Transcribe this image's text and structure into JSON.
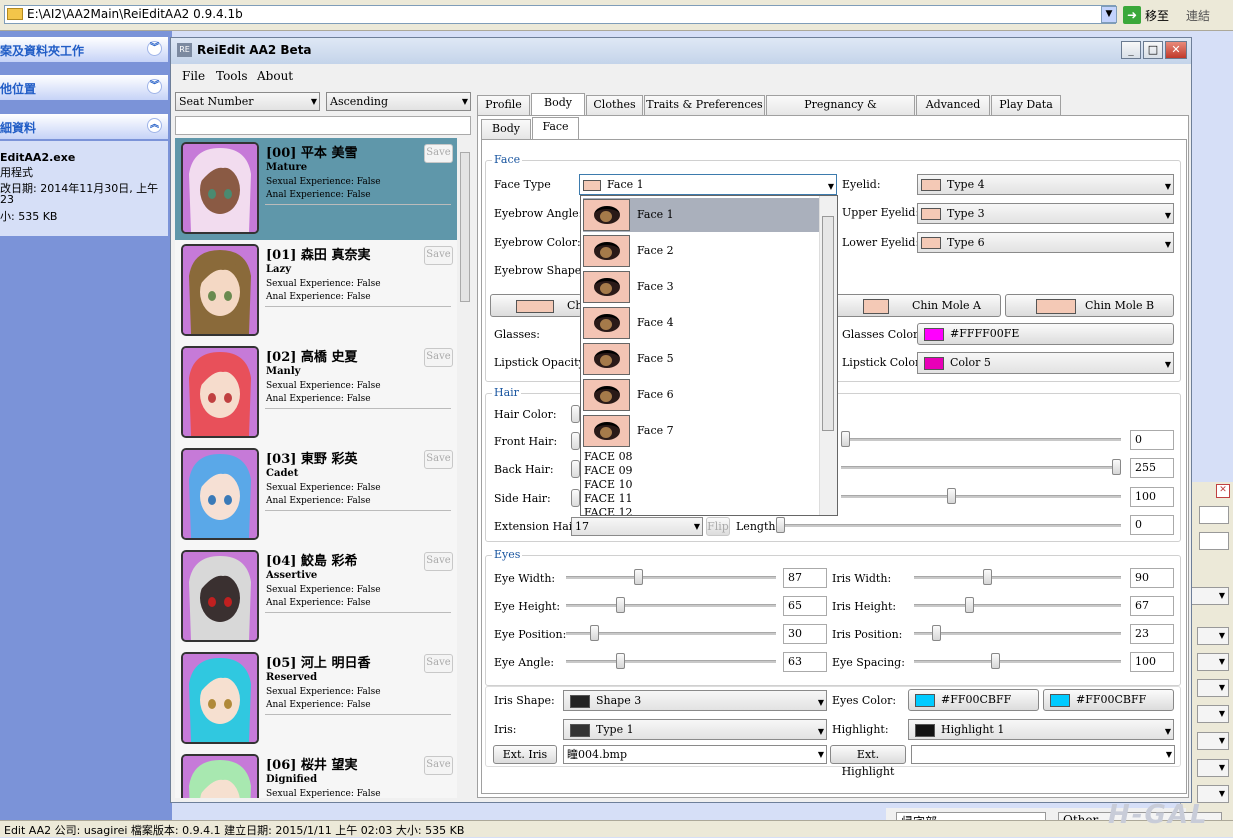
{
  "explorer": {
    "address": "E:\\AI2\\AA2Main\\ReiEditAA2 0.9.4.1b",
    "go_label": "移至",
    "links_label": "連結",
    "left_panel": {
      "sections": [
        "案及資料夾工作",
        "他位置",
        "細資料"
      ],
      "file_name": "EditAA2.exe",
      "file_type": "用程式",
      "modified": "改日期: 2014年11月30日, 上午",
      "modified2": "23",
      "size": "小: 535 KB"
    },
    "statusbar": "Edit AA2 公司: usagirei 檔案版本: 0.9.4.1 建立日期: 2015/1/11 上午 02:03 大小: 535 KB",
    "bg_field1": "帰宅部",
    "bg_field2": "Other",
    "watermark": "H-GAL"
  },
  "app": {
    "title": "ReiEdit AA2 Beta",
    "icon_text": "RE",
    "menu": [
      "File",
      "Tools",
      "About"
    ],
    "sort_field": "Seat Number",
    "sort_order": "Ascending",
    "save_label": "Save",
    "characters": [
      {
        "name": "[00] 平本 美雪",
        "personality": "Mature",
        "sexual": "Sexual Experience: False",
        "anal": "Anal Experience: False",
        "hair": "#f2dcef",
        "skin": "#8a5a44",
        "bg": "#c67ad8",
        "eyes": "#4a8a70"
      },
      {
        "name": "[01] 森田 真奈実",
        "personality": "Lazy",
        "sexual": "Sexual Experience: False",
        "anal": "Anal Experience: False",
        "hair": "#8a6a3a",
        "skin": "#f4d8c4",
        "bg": "#c67ad8",
        "eyes": "#6a8a50"
      },
      {
        "name": "[02] 高橋 史夏",
        "personality": "Manly",
        "sexual": "Sexual Experience: False",
        "anal": "Anal Experience: False",
        "hair": "#e8505a",
        "skin": "#f6dccc",
        "bg": "#c67ad8",
        "eyes": "#c04040"
      },
      {
        "name": "[03] 東野 彩英",
        "personality": "Cadet",
        "sexual": "Sexual Experience: False",
        "anal": "Anal Experience: False",
        "hair": "#5aa8e8",
        "skin": "#f6e0d4",
        "bg": "#c67ad8",
        "eyes": "#3a7ab8"
      },
      {
        "name": "[04] 鮫島 彩希",
        "personality": "Assertive",
        "sexual": "Sexual Experience: False",
        "anal": "Anal Experience: False",
        "hair": "#d8d8d8",
        "skin": "#3a3030",
        "bg": "#c67ad8",
        "eyes": "#c02020"
      },
      {
        "name": "[05] 河上 明日香",
        "personality": "Reserved",
        "sexual": "Sexual Experience: False",
        "anal": "Anal Experience: False",
        "hair": "#30c8e0",
        "skin": "#f6e0d0",
        "bg": "#c67ad8",
        "eyes": "#b08a3a"
      },
      {
        "name": "[06] 桜井 望実",
        "personality": "Dignified",
        "sexual": "Sexual Experience: False",
        "anal": "Anal Experience: False",
        "hair": "#a8e8b0",
        "skin": "#f6e0d0",
        "bg": "#c67ad8",
        "eyes": "#6a8a50"
      }
    ],
    "tabs": [
      "Profile",
      "Body",
      "Clothes",
      "Traits & Preferences",
      "Pregnancy & Compatibility",
      "Advanced",
      "Play Data"
    ],
    "subtabs": [
      "Body",
      "Face"
    ],
    "face": {
      "group": "Face",
      "face_type_label": "Face Type",
      "face_type_value": "Face 1",
      "eyebrow_angle_label": "Eyebrow Angle:",
      "eyebrow_color_label": "Eyebrow Color:",
      "eyebrow_shape_label": "Eyebrow Shape:",
      "eyelid_label": "Eyelid:",
      "eyelid_value": "Type 4",
      "upper_eyelid_label": "Upper Eyelid:",
      "upper_eyelid_value": "Type 3",
      "lower_eyelid_label": "Lower Eyelid:",
      "lower_eyelid_value": "Type 6",
      "cheek_button": "Ch",
      "chin_a": "Chin Mole A",
      "chin_b": "Chin Mole B",
      "glasses_label": "Glasses:",
      "glasses_color_label": "Glasses Color:",
      "glasses_color_value": "#FFFF00FE",
      "lipstick_opacity_label": "Lipstick Opacity:",
      "lipstick_color_label": "Lipstick Color:",
      "lipstick_color_value": "Color 5",
      "dropdown_items": [
        "Face 1",
        "Face 2",
        "Face 3",
        "Face 4",
        "Face 5",
        "Face 6",
        "Face 7"
      ],
      "dropdown_text_items": [
        "FACE 08",
        "FACE 09",
        "FACE 10",
        "FACE 11",
        "FACE 12"
      ]
    },
    "hair": {
      "group": "Hair",
      "hair_color_label": "Hair Color:",
      "front_label": "Front Hair:",
      "back_label": "Back Hair:",
      "side_label": "Side Hair:",
      "ext_label": "Extension Hair:",
      "ext_value": "17",
      "flip_label": "Flip",
      "length_label": "Length:",
      "front_length": "0",
      "back_length": "255",
      "side_length": "100",
      "ext_length": "0",
      "front_fraction": 0,
      "back_fraction": 1,
      "side_fraction": 0.39,
      "ext_fraction": 0
    },
    "eyes": {
      "group": "Eyes",
      "eye_width_label": "Eye Width:",
      "eye_width": "87",
      "eye_width_fraction": 0.34,
      "eye_height_label": "Eye Height:",
      "eye_height": "65",
      "eye_height_fraction": 0.25,
      "eye_position_label": "Eye Position:",
      "eye_position": "30",
      "eye_position_fraction": 0.12,
      "eye_angle_label": "Eye Angle:",
      "eye_angle": "63",
      "eye_angle_fraction": 0.25,
      "iris_width_label": "Iris Width:",
      "iris_width": "90",
      "iris_width_fraction": 0.35,
      "iris_height_label": "Iris Height:",
      "iris_height": "67",
      "iris_height_fraction": 0.26,
      "iris_position_label": "Iris Position:",
      "iris_position": "23",
      "iris_position_fraction": 0.09,
      "eye_spacing_label": "Eye Spacing:",
      "eye_spacing": "100",
      "eye_spacing_fraction": 0.39,
      "iris_shape_label": "Iris Shape:",
      "iris_shape_value": "Shape 3",
      "eyes_color_label": "Eyes Color:",
      "eyes_color_1": "#FF00CBFF",
      "eyes_color_2": "#FF00CBFF",
      "iris_label": "Iris:",
      "iris_value": "Type 1",
      "highlight_label": "Highlight:",
      "highlight_value": "Highlight 1",
      "ext_iris_button": "Ext. Iris",
      "ext_iris_value": "瞳004.bmp",
      "ext_highlight_button": "Ext. Highlight",
      "ext_highlight_value": ""
    },
    "colors": {
      "glasses": "#FF00FE",
      "lipstick": "#E800B8",
      "eyes": "#00CBFF",
      "selected_row": "#5f97aa"
    }
  }
}
